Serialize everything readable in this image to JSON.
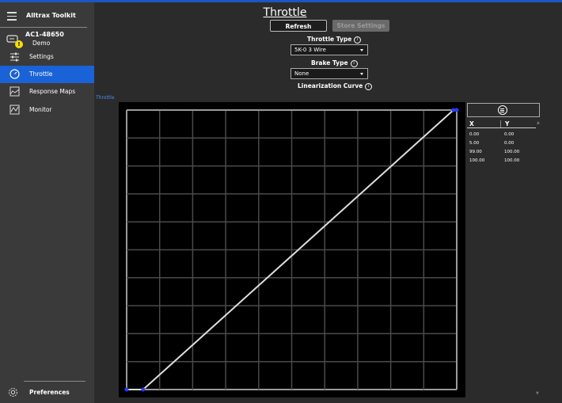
{
  "app": {
    "title": "Alltrax Toolkit"
  },
  "device": {
    "id": "AC1-48650",
    "subtitle": "Demo"
  },
  "sidebar": {
    "items": [
      {
        "label": "Settings",
        "icon": "sliders-icon"
      },
      {
        "label": "Throttle",
        "icon": "gauge-icon",
        "active": true
      },
      {
        "label": "Response Maps",
        "icon": "area-chart-icon"
      },
      {
        "label": "Monitor",
        "icon": "line-chart-icon"
      }
    ],
    "preferences_label": "Preferences"
  },
  "page": {
    "title": "Throttle",
    "refresh_label": "Refresh",
    "store_label": "Store Settings",
    "throttle_type_label": "Throttle Type",
    "throttle_type_value": "5K-0 3 Wire",
    "brake_type_label": "Brake Type",
    "brake_type_value": "None",
    "linearization_label": "Linearization Curve",
    "chart_small_label": "Throttle"
  },
  "table": {
    "headers": [
      "X",
      "Y"
    ],
    "rows": [
      [
        "0.00",
        "0.00"
      ],
      [
        "5.00",
        "0.00"
      ],
      [
        "99.00",
        "100.00"
      ],
      [
        "100.00",
        "100.00"
      ]
    ]
  },
  "chart_data": {
    "type": "line",
    "series": [
      {
        "x": [
          0,
          5,
          99,
          100
        ],
        "y": [
          0,
          0,
          100,
          100
        ]
      }
    ],
    "xlim": [
      0,
      100
    ],
    "ylim": [
      0,
      100
    ],
    "grid": true,
    "line_color": "#dcdcdc",
    "point_color": "#2a3cff",
    "background": "#000000"
  },
  "colors": {
    "accent": "#1a62d8",
    "warning": "#f6e000"
  }
}
